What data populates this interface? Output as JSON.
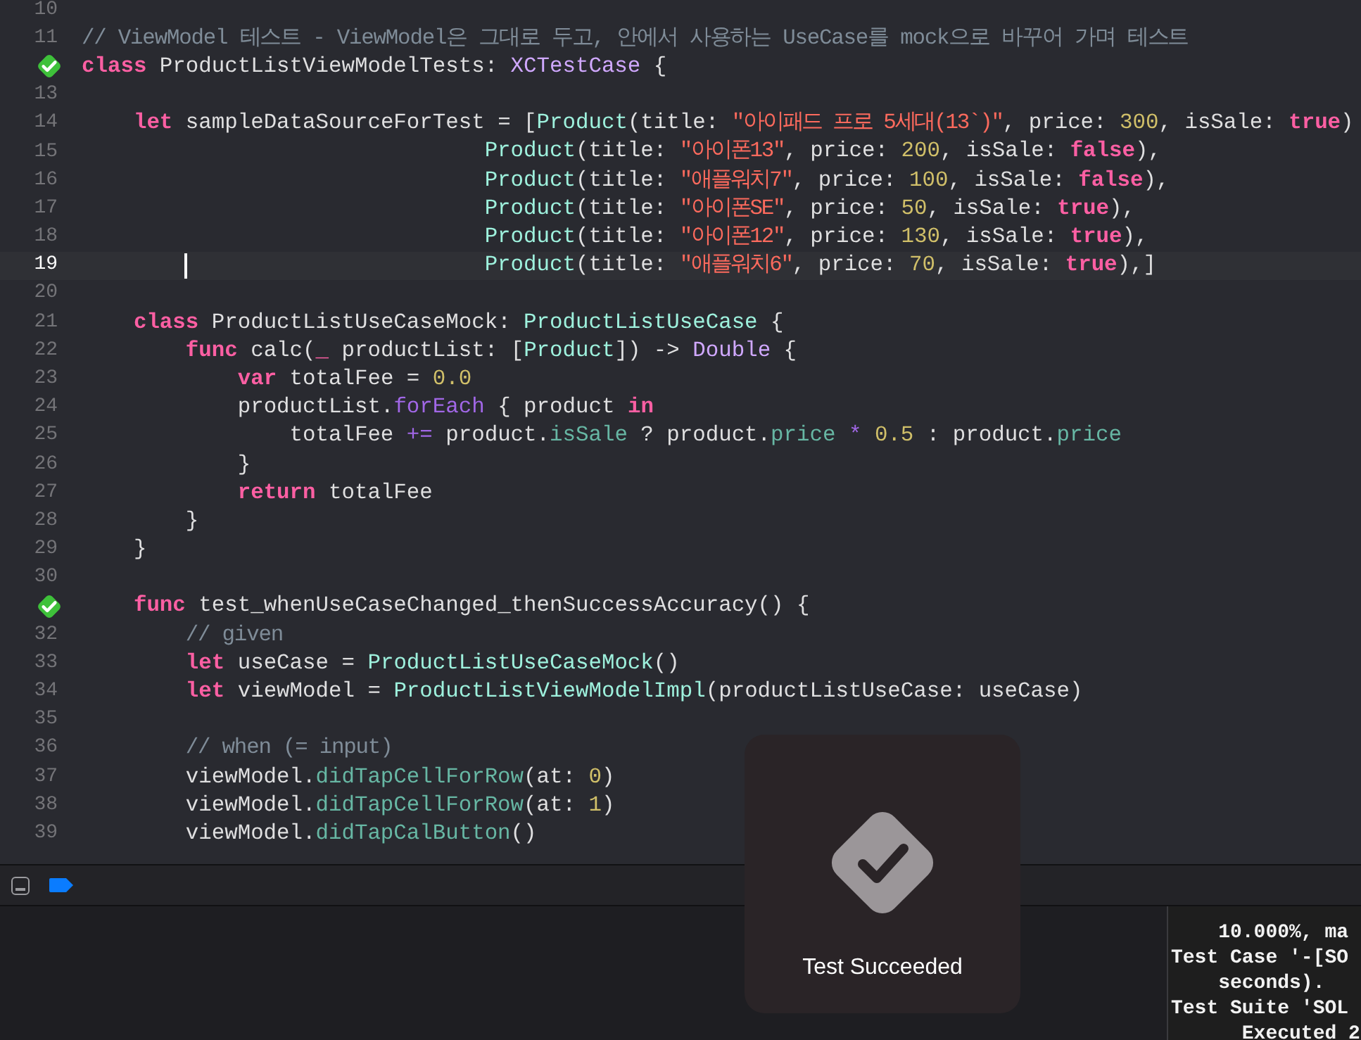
{
  "editor": {
    "lines": [
      {
        "number": "10",
        "test_passed": false
      },
      {
        "number": "11",
        "test_passed": false,
        "tokens": [
          {
            "kind": "comment",
            "text": "// ViewModel 테스트 - ViewModel은 그대로 두고, 안에서 사용하는 UseCase를 mock으로 바꾸어 가며 테스트"
          }
        ]
      },
      {
        "test_passed": true,
        "tokens": [
          {
            "kind": "kw",
            "text": "class"
          },
          {
            "kind": "plain",
            "text": " ProductListViewModelTests: "
          },
          {
            "kind": "stype",
            "text": "XCTestCase"
          },
          {
            "kind": "plain",
            "text": " {"
          }
        ]
      },
      {
        "number": "13",
        "test_passed": false
      },
      {
        "number": "14",
        "test_passed": false,
        "tokens": [
          {
            "kind": "kw",
            "text": "    let"
          },
          {
            "kind": "plain",
            "text": " sampleDataSourceForTest = ["
          },
          {
            "kind": "ptype",
            "text": "Product"
          },
          {
            "kind": "plain",
            "text": "(title: "
          },
          {
            "kind": "str",
            "text": "\"아이패드 프로 5세대(13`)\""
          },
          {
            "kind": "plain",
            "text": ", price: "
          },
          {
            "kind": "num",
            "text": "300"
          },
          {
            "kind": "plain",
            "text": ", isSale: "
          },
          {
            "kind": "kw",
            "text": "true"
          },
          {
            "kind": "plain",
            "text": ")"
          }
        ]
      },
      {
        "number": "15",
        "test_passed": false,
        "tokens": [
          {
            "kind": "ptype",
            "text": "                               Product"
          },
          {
            "kind": "plain",
            "text": "(title: "
          },
          {
            "kind": "str",
            "text": "\"아이폰13\""
          },
          {
            "kind": "plain",
            "text": ", price: "
          },
          {
            "kind": "num",
            "text": "200"
          },
          {
            "kind": "plain",
            "text": ", isSale: "
          },
          {
            "kind": "kw",
            "text": "false"
          },
          {
            "kind": "plain",
            "text": "),"
          }
        ]
      },
      {
        "number": "16",
        "test_passed": false,
        "tokens": [
          {
            "kind": "ptype",
            "text": "                               Product"
          },
          {
            "kind": "plain",
            "text": "(title: "
          },
          {
            "kind": "str",
            "text": "\"애플워치7\""
          },
          {
            "kind": "plain",
            "text": ", price: "
          },
          {
            "kind": "num",
            "text": "100"
          },
          {
            "kind": "plain",
            "text": ", isSale: "
          },
          {
            "kind": "kw",
            "text": "false"
          },
          {
            "kind": "plain",
            "text": "),"
          }
        ]
      },
      {
        "number": "17",
        "test_passed": false,
        "tokens": [
          {
            "kind": "ptype",
            "text": "                               Product"
          },
          {
            "kind": "plain",
            "text": "(title: "
          },
          {
            "kind": "str",
            "text": "\"아이폰SE\""
          },
          {
            "kind": "plain",
            "text": ", price: "
          },
          {
            "kind": "num",
            "text": "50"
          },
          {
            "kind": "plain",
            "text": ", isSale: "
          },
          {
            "kind": "kw",
            "text": "true"
          },
          {
            "kind": "plain",
            "text": "),"
          }
        ]
      },
      {
        "number": "18",
        "test_passed": false,
        "tokens": [
          {
            "kind": "ptype",
            "text": "                               Product"
          },
          {
            "kind": "plain",
            "text": "(title: "
          },
          {
            "kind": "str",
            "text": "\"아이폰12\""
          },
          {
            "kind": "plain",
            "text": ", price: "
          },
          {
            "kind": "num",
            "text": "130"
          },
          {
            "kind": "plain",
            "text": ", isSale: "
          },
          {
            "kind": "kw",
            "text": "true"
          },
          {
            "kind": "plain",
            "text": "),"
          }
        ]
      },
      {
        "number": "19",
        "test_passed": false,
        "current": true,
        "tokens": [
          {
            "kind": "ptype",
            "text": "                               Product"
          },
          {
            "kind": "plain",
            "text": "(title: "
          },
          {
            "kind": "str",
            "text": "\"애플워치6\""
          },
          {
            "kind": "plain",
            "text": ", price: "
          },
          {
            "kind": "num",
            "text": "70"
          },
          {
            "kind": "plain",
            "text": ", isSale: "
          },
          {
            "kind": "kw",
            "text": "true"
          },
          {
            "kind": "plain",
            "text": "),]"
          }
        ]
      },
      {
        "number": "20",
        "test_passed": false
      },
      {
        "number": "21",
        "test_passed": false,
        "tokens": [
          {
            "kind": "kw",
            "text": "    class"
          },
          {
            "kind": "plain",
            "text": " ProductListUseCaseMock: "
          },
          {
            "kind": "ptype",
            "text": "ProductListUseCase"
          },
          {
            "kind": "plain",
            "text": " {"
          }
        ]
      },
      {
        "number": "22",
        "test_passed": false,
        "tokens": [
          {
            "kind": "kw",
            "text": "        func"
          },
          {
            "kind": "plain",
            "text": " calc("
          },
          {
            "kind": "kw",
            "text": "_"
          },
          {
            "kind": "plain",
            "text": " productList: ["
          },
          {
            "kind": "ptype",
            "text": "Product"
          },
          {
            "kind": "plain",
            "text": "]) -> "
          },
          {
            "kind": "stype",
            "text": "Double"
          },
          {
            "kind": "plain",
            "text": " {"
          }
        ]
      },
      {
        "number": "23",
        "test_passed": false,
        "tokens": [
          {
            "kind": "kw",
            "text": "            var"
          },
          {
            "kind": "plain",
            "text": " totalFee = "
          },
          {
            "kind": "num",
            "text": "0.0"
          }
        ]
      },
      {
        "number": "24",
        "test_passed": false,
        "tokens": [
          {
            "kind": "plain",
            "text": "            productList."
          },
          {
            "kind": "sfunc",
            "text": "forEach"
          },
          {
            "kind": "plain",
            "text": " { product "
          },
          {
            "kind": "kw",
            "text": "in"
          }
        ]
      },
      {
        "number": "25",
        "test_passed": false,
        "tokens": [
          {
            "kind": "plain",
            "text": "                totalFee "
          },
          {
            "kind": "sfunc",
            "text": "+="
          },
          {
            "kind": "plain",
            "text": " product."
          },
          {
            "kind": "pfunc",
            "text": "isSale"
          },
          {
            "kind": "plain",
            "text": " ? product."
          },
          {
            "kind": "pfunc",
            "text": "price"
          },
          {
            "kind": "sfunc",
            "text": " *"
          },
          {
            "kind": "num",
            "text": " 0.5"
          },
          {
            "kind": "plain",
            "text": " : product."
          },
          {
            "kind": "pfunc",
            "text": "price"
          }
        ]
      },
      {
        "number": "26",
        "test_passed": false,
        "tokens": [
          {
            "kind": "plain",
            "text": "            }"
          }
        ]
      },
      {
        "number": "27",
        "test_passed": false,
        "tokens": [
          {
            "kind": "kw",
            "text": "            return"
          },
          {
            "kind": "plain",
            "text": " totalFee"
          }
        ]
      },
      {
        "number": "28",
        "test_passed": false,
        "tokens": [
          {
            "kind": "plain",
            "text": "        }"
          }
        ]
      },
      {
        "number": "29",
        "test_passed": false,
        "tokens": [
          {
            "kind": "plain",
            "text": "    }"
          }
        ]
      },
      {
        "number": "30",
        "test_passed": false
      },
      {
        "test_passed": true,
        "tokens": [
          {
            "kind": "kw",
            "text": "    func"
          },
          {
            "kind": "plain",
            "text": " test_whenUseCaseChanged_thenSuccessAccuracy() {"
          }
        ]
      },
      {
        "number": "32",
        "test_passed": false,
        "tokens": [
          {
            "kind": "comment",
            "text": "        // given"
          }
        ]
      },
      {
        "number": "33",
        "test_passed": false,
        "tokens": [
          {
            "kind": "kw",
            "text": "        let"
          },
          {
            "kind": "plain",
            "text": " useCase = "
          },
          {
            "kind": "ptype",
            "text": "ProductListUseCaseMock"
          },
          {
            "kind": "plain",
            "text": "()"
          }
        ]
      },
      {
        "number": "34",
        "test_passed": false,
        "tokens": [
          {
            "kind": "kw",
            "text": "        let"
          },
          {
            "kind": "plain",
            "text": " viewModel = "
          },
          {
            "kind": "ptype",
            "text": "ProductListViewModelImpl"
          },
          {
            "kind": "plain",
            "text": "(productListUseCase: useCase)"
          }
        ]
      },
      {
        "number": "35",
        "test_passed": false
      },
      {
        "number": "36",
        "test_passed": false,
        "tokens": [
          {
            "kind": "comment",
            "text": "        // when (= input)"
          }
        ]
      },
      {
        "number": "37",
        "test_passed": false,
        "tokens": [
          {
            "kind": "plain",
            "text": "        viewModel."
          },
          {
            "kind": "pfunc",
            "text": "didTapCellForRow"
          },
          {
            "kind": "plain",
            "text": "(at: "
          },
          {
            "kind": "num",
            "text": "0"
          },
          {
            "kind": "plain",
            "text": ")"
          }
        ]
      },
      {
        "number": "38",
        "test_passed": false,
        "tokens": [
          {
            "kind": "plain",
            "text": "        viewModel."
          },
          {
            "kind": "pfunc",
            "text": "didTapCellForRow"
          },
          {
            "kind": "plain",
            "text": "(at: "
          },
          {
            "kind": "num",
            "text": "1"
          },
          {
            "kind": "plain",
            "text": ")"
          }
        ]
      },
      {
        "number": "39",
        "test_passed": false,
        "tokens": [
          {
            "kind": "plain",
            "text": "        viewModel."
          },
          {
            "kind": "pfunc",
            "text": "didTapCalButton"
          },
          {
            "kind": "plain",
            "text": "()"
          }
        ]
      }
    ]
  },
  "console": {
    "lines": [
      "    10.000%, ma",
      "Test Case '-[SO",
      "    seconds).",
      "Test Suite 'SOL",
      "      Executed 2"
    ]
  },
  "hud": {
    "message": "Test Succeeded"
  }
}
